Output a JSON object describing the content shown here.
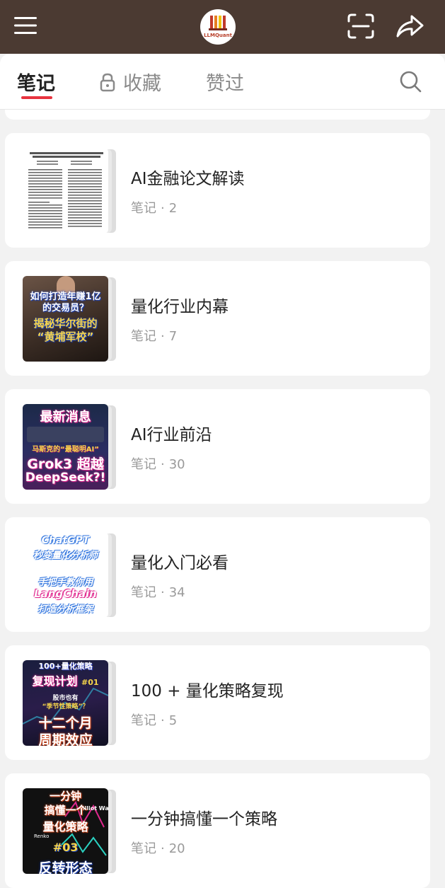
{
  "header": {
    "logo_text": "LLMQuant",
    "icons": {
      "menu": "menu-icon",
      "scan": "scan-icon",
      "share": "share-icon"
    },
    "background": "#4b3a32"
  },
  "tabs": {
    "notes": "笔记",
    "favorites": "收藏",
    "liked": "赞过",
    "accent": "#e8333f"
  },
  "meta_label": "笔记",
  "collections": [
    {
      "title": "AI金融论文解读",
      "count": "2"
    },
    {
      "title": "量化行业内幕",
      "count": "7",
      "cover": {
        "line1": "如何打造年赚1亿",
        "line2": "的交易员？",
        "line3": "揭秘华尔街的",
        "line4": "“黄埔军校”"
      }
    },
    {
      "title": "AI行业前沿",
      "count": "30",
      "cover": {
        "line1": "最新消息",
        "line2": "马斯克的“最聪明AI”",
        "line3": "Grok3 超越",
        "line4": "DeepSeek?!"
      }
    },
    {
      "title": "量化入门必看",
      "count": "34",
      "cover": {
        "line1": "ChatGPT",
        "line2": "秒变量化分析师",
        "line3": "手把手教你用",
        "line4": "LangChain",
        "line5": "打造分析框架"
      }
    },
    {
      "title": "100 + 量化策略复现",
      "count": "5",
      "cover": {
        "line1": "100+量化策略",
        "line2": "复现计划",
        "line2b": "#01",
        "line3": "股市也有",
        "line3b": "“季节性策略”？",
        "line4": "十二个月",
        "line5": "周期效应"
      }
    },
    {
      "title": "一分钟搞懂一个策略",
      "count": "20",
      "cover": {
        "line1": "一分钟",
        "line2": "搞懂一个",
        "line3": "量化策略",
        "line4": "#03",
        "line5": "反转形态",
        "tag1": "Elliot Wave",
        "tag2": "Renko"
      }
    }
  ]
}
